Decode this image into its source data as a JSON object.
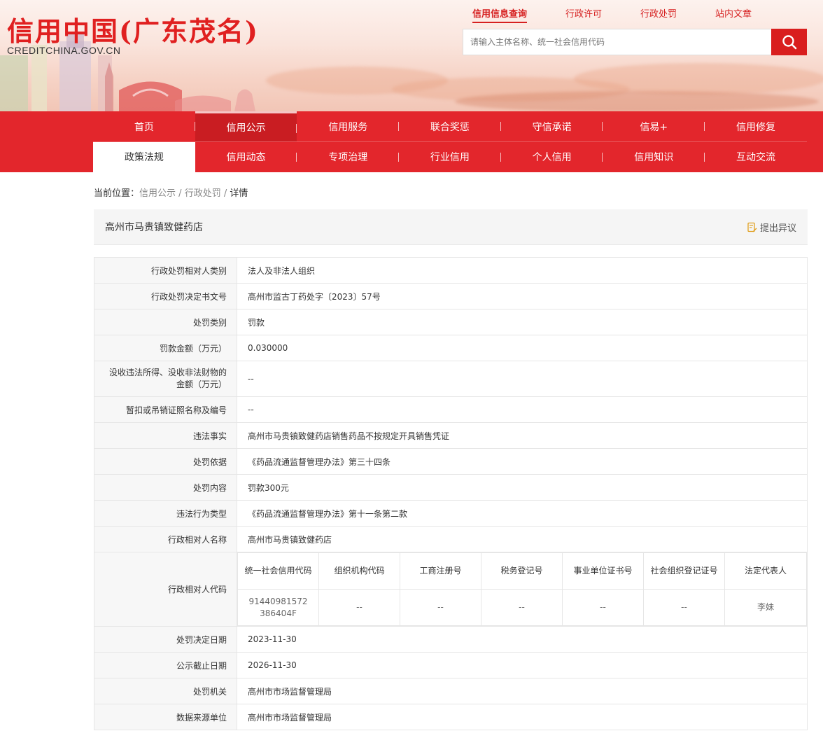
{
  "site": {
    "title": "信用中国(广东茂名)",
    "subtitle": "CREDITCHINA.GOV.CN"
  },
  "top_links": [
    {
      "label": "信用信息查询",
      "active": true
    },
    {
      "label": "行政许可",
      "active": false
    },
    {
      "label": "行政处罚",
      "active": false
    },
    {
      "label": "站内文章",
      "active": false
    }
  ],
  "search": {
    "placeholder": "请输入主体名称、统一社会信用代码"
  },
  "nav": {
    "row1": [
      "首页",
      "信用公示",
      "信用服务",
      "联合奖惩",
      "守信承诺",
      "信易+",
      "信用修复"
    ],
    "row2": [
      "政策法规",
      "信用动态",
      "专项治理",
      "行业信用",
      "个人信用",
      "信用知识",
      "互动交流"
    ]
  },
  "breadcrumb": {
    "prefix": "当前位置：",
    "items": [
      "信用公示",
      "行政处罚",
      "详情"
    ],
    "sep": "/"
  },
  "record": {
    "name": "高州市马贵镇致健药店",
    "objection_label": "提出异议"
  },
  "fields": [
    {
      "label": "行政处罚相对人类别",
      "value": "法人及非法人组织"
    },
    {
      "label": "行政处罚决定书文号",
      "value": "高州市监古丁药处字〔2023〕57号"
    },
    {
      "label": "处罚类别",
      "value": "罚款"
    },
    {
      "label": "罚款金额（万元）",
      "value": "0.030000"
    },
    {
      "label": "没收违法所得、没收非法财物的金额（万元）",
      "value": "--"
    },
    {
      "label": "暂扣或吊销证照名称及编号",
      "value": "--"
    },
    {
      "label": "违法事实",
      "value": "高州市马贵镇致健药店销售药品不按规定开具销售凭证"
    },
    {
      "label": "处罚依据",
      "value": "《药品流通监督管理办法》第三十四条"
    },
    {
      "label": "处罚内容",
      "value": "罚款300元"
    },
    {
      "label": "违法行为类型",
      "value": "《药品流通监督管理办法》第十一条第二款"
    },
    {
      "label": "行政相对人名称",
      "value": "高州市马贵镇致健药店"
    }
  ],
  "codes": {
    "label": "行政相对人代码",
    "headers": [
      "统一社会信用代码",
      "组织机构代码",
      "工商注册号",
      "税务登记号",
      "事业单位证书号",
      "社会组织登记证号",
      "法定代表人"
    ],
    "values": [
      "91440981572386404F",
      "--",
      "--",
      "--",
      "--",
      "--",
      "李妹"
    ]
  },
  "fields2": [
    {
      "label": "处罚决定日期",
      "value": "2023-11-30"
    },
    {
      "label": "公示截止日期",
      "value": "2026-11-30"
    },
    {
      "label": "处罚机关",
      "value": "高州市市场监督管理局"
    },
    {
      "label": "数据来源单位",
      "value": "高州市市场监督管理局"
    }
  ],
  "colors": {
    "brand_red": "#e3262c",
    "search_button": "#d91e1e"
  }
}
